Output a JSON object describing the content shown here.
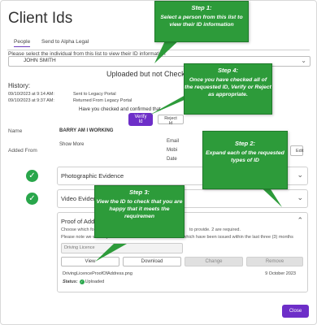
{
  "dialog": {
    "title": "Client Ids",
    "close_label": "Close"
  },
  "tabs": [
    {
      "label": "People"
    },
    {
      "label": "Send to Alpha Legal"
    }
  ],
  "person_select": {
    "instruction": "Please select the individual from this list to view their ID information",
    "value": "JOHN SMITH"
  },
  "status_banner": "Uploaded but not Checked",
  "history": {
    "label": "History:",
    "rows": [
      {
        "time": "09/10/2023 at 9:14 AM:",
        "action": "Sent to Legacy Portal"
      },
      {
        "time": "09/10/2023 at 9:37 AM:",
        "action": "Returned From Legacy Portal"
      }
    ]
  },
  "verify": {
    "question": "Have you checked and confirmed that",
    "verify_label": "Verify Id",
    "reject_label": "Reject Id"
  },
  "details": {
    "name_label": "Name",
    "name_value": "BARRY AM I WORKING",
    "added_from_label": "Added From",
    "show_more": "Show More",
    "cut_email": "Email",
    "cut_mobile": "Mobi",
    "cut_date": "Date",
    "cut_k": "k",
    "edit_label": "Edit"
  },
  "sections": {
    "photographic": "Photographic Evidence",
    "video": "Video Evidence",
    "proof": "Proof of Address"
  },
  "proof": {
    "line1_a": "Choose which forms",
    "line1_b": "to provide. 2 are required.",
    "line2_a": "Please note we will only ac",
    "line2_b": "documents which have been issued within the last three (3) months",
    "dropdown_value": "Driving Licence",
    "view_label": "View",
    "download_label": "Download",
    "change_label": "Change",
    "remove_label": "Remove",
    "filename": "DrivingLicenceProofOfAddress.png",
    "file_date": "9 October 2023",
    "status_label": "Status:",
    "status_value": "Uploaded"
  },
  "callouts": {
    "step1": {
      "title": "Step 1:",
      "text": "Select a person from this list to view their ID information"
    },
    "step4": {
      "title": "Step 4:",
      "text": "Once you have checked all of the requested ID, Verify or Reject as appropriate."
    },
    "step2": {
      "title": "Step 2:",
      "text": "Expand each of the requested types of ID"
    },
    "step3": {
      "title": "Step 3:",
      "text": "View the ID to check that you are happy that it meets the requiremen"
    }
  },
  "colors": {
    "accent": "#6d2ec8",
    "callout": "#2d9b3a",
    "success": "#29a64b"
  }
}
